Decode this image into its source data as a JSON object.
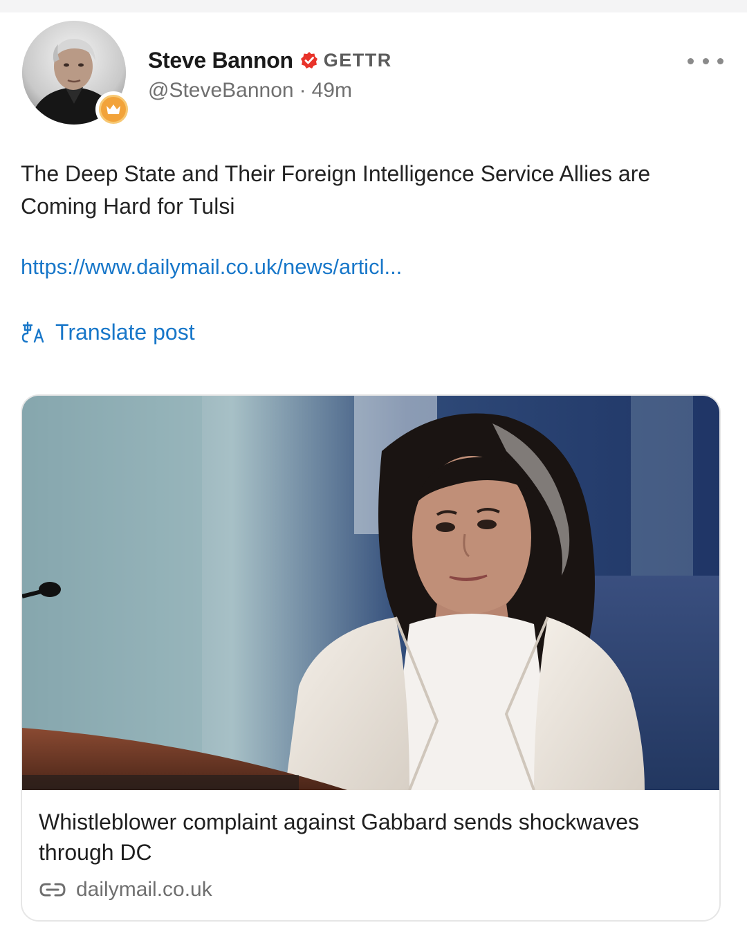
{
  "post": {
    "author_name": "Steve Bannon",
    "platform_tag": "GETTR",
    "handle": "@SteveBannon",
    "separator": "·",
    "time_ago": "49m",
    "text": "The Deep State and Their Foreign Intelligence Service Allies are Coming Hard for Tulsi",
    "link_text": "https://www.dailymail.co.uk/news/articl...",
    "translate_label": "Translate post"
  },
  "link_card": {
    "title": "Whistleblower complaint against Gabbard sends shockwaves through DC",
    "source": "dailymail.co.uk"
  },
  "icons": {
    "verified": "verified-badge-icon",
    "crown": "crown-icon",
    "more": "more-options-icon",
    "translate": "translate-icon",
    "link": "link-icon"
  },
  "colors": {
    "link_blue": "#1877c9",
    "verified_red": "#e8332a",
    "crown_gold": "#f2a33a",
    "muted_gray": "#6f6f6f"
  }
}
